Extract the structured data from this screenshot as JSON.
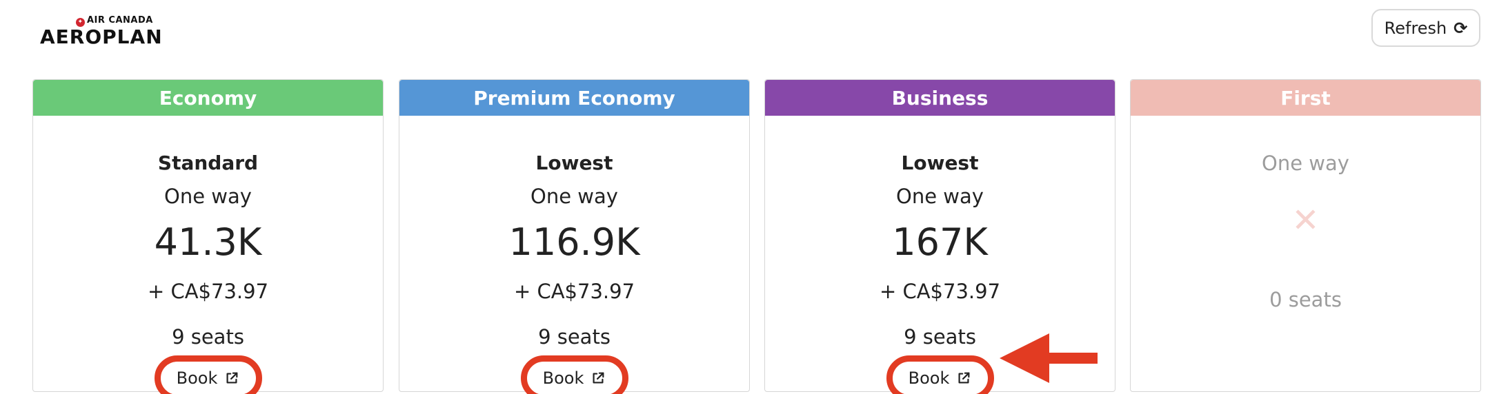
{
  "logo": {
    "top": "AIR CANADA",
    "main": "AEROPLAN"
  },
  "refresh": {
    "label": "Refresh",
    "icon": "refresh-icon"
  },
  "colors": {
    "economy": "#6ac978",
    "premium_economy": "#5596d6",
    "business": "#8748a9",
    "first": "#f0bcb4",
    "highlight": "#e23b22"
  },
  "cards": [
    {
      "cabin": "Economy",
      "fare_type": "Standard",
      "trip": "One way",
      "points": "41.3K",
      "taxes": "+ CA$73.97",
      "seats": "9 seats",
      "book_label": "Book"
    },
    {
      "cabin": "Premium Economy",
      "fare_type": "Lowest",
      "trip": "One way",
      "points": "116.9K",
      "taxes": "+ CA$73.97",
      "seats": "9 seats",
      "book_label": "Book"
    },
    {
      "cabin": "Business",
      "fare_type": "Lowest",
      "trip": "One way",
      "points": "167K",
      "taxes": "+ CA$73.97",
      "seats": "9 seats",
      "book_label": "Book"
    },
    {
      "cabin": "First",
      "trip": "One way",
      "unavailable_icon": "x-icon",
      "seats": "0 seats"
    }
  ]
}
